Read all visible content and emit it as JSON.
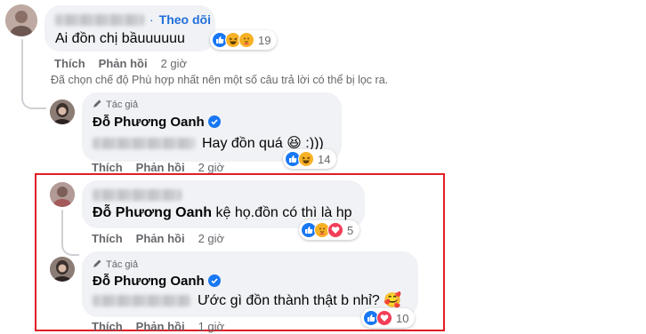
{
  "comment1": {
    "follow_label": "Theo dõi",
    "text": "Ai đồn chị bầuuuuuu",
    "like_label": "Thích",
    "reply_label": "Phản hồi",
    "time": "2 giờ",
    "reactions": [
      "like-icon",
      "haha-icon",
      "care-icon"
    ],
    "reaction_count": "19"
  },
  "filter_notice": "Đã chọn chế độ Phù hợp nhất nên một số câu trả lời có thể bị lọc ra.",
  "reply1": {
    "author_tag": "Tác giả",
    "author_name": "Đỗ Phương Oanh",
    "text": "Hay đồn quá 😆 :)))",
    "like_label": "Thích",
    "reply_label": "Phản hồi",
    "time": "2 giờ",
    "reactions": [
      "like-icon",
      "haha-icon"
    ],
    "reaction_count": "14"
  },
  "comment2": {
    "mention": "Đỗ Phương Oanh",
    "text": "kệ họ.đồn có thì là hp",
    "like_label": "Thích",
    "reply_label": "Phản hồi",
    "time": "2 giờ",
    "reactions": [
      "like-icon",
      "care-icon",
      "love-icon"
    ],
    "reaction_count": "5"
  },
  "reply2": {
    "author_tag": "Tác giả",
    "author_name": "Đỗ Phương Oanh",
    "text": "Ước gì đồn thành thật b nhỉ? 🥰",
    "like_label": "Thích",
    "reply_label": "Phản hồi",
    "time": "1 giờ",
    "reactions": [
      "like-icon",
      "love-icon"
    ],
    "reaction_count": "10"
  },
  "colors": {
    "highlight_border": "#e01e25",
    "link_blue": "#216fdb",
    "bubble_bg": "#f0f2f5",
    "meta_gray": "#65676b"
  }
}
